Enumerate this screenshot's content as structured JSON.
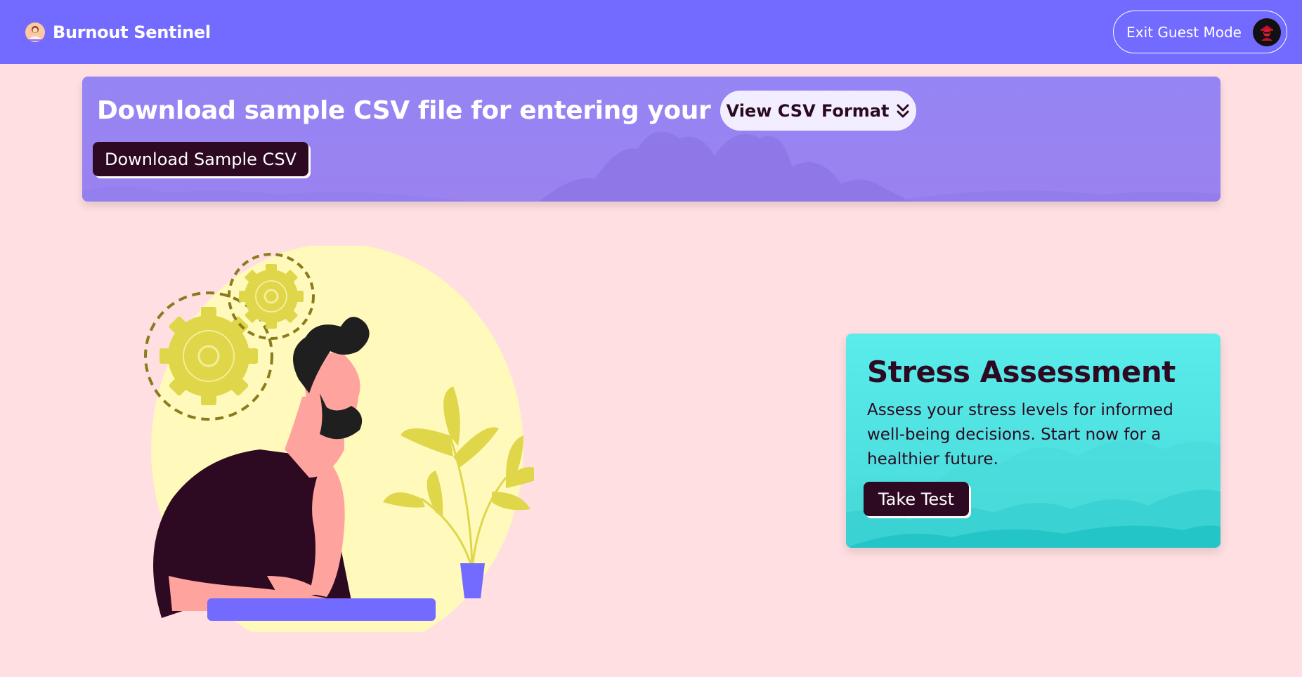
{
  "navbar": {
    "brand_name": "Burnout Sentinel",
    "logo_icon": "meditating-person-logo",
    "exit_guest_label": "Exit Guest Mode",
    "avatar_icon": "hacker-avatar-icon",
    "background_color": "#736bff"
  },
  "csv_banner": {
    "title": "Download sample CSV file for entering your data",
    "view_format_label": "View CSV Format",
    "view_format_icon": "double-chevron-down-icon",
    "download_label": "Download Sample CSV"
  },
  "stress_card": {
    "title": "Stress Assessment",
    "description": "Assess your stress levels for informed well-being decisions. Start now for a healthier future.",
    "button_label": "Take Test"
  },
  "illustration": {
    "icon": "thinking-man-with-gears-illustration"
  },
  "colors": {
    "page_background": "#ffdfe1",
    "dark_button": "#2e0a22",
    "card_teal": "#52e6e4",
    "banner_purple": "#9585f4"
  }
}
